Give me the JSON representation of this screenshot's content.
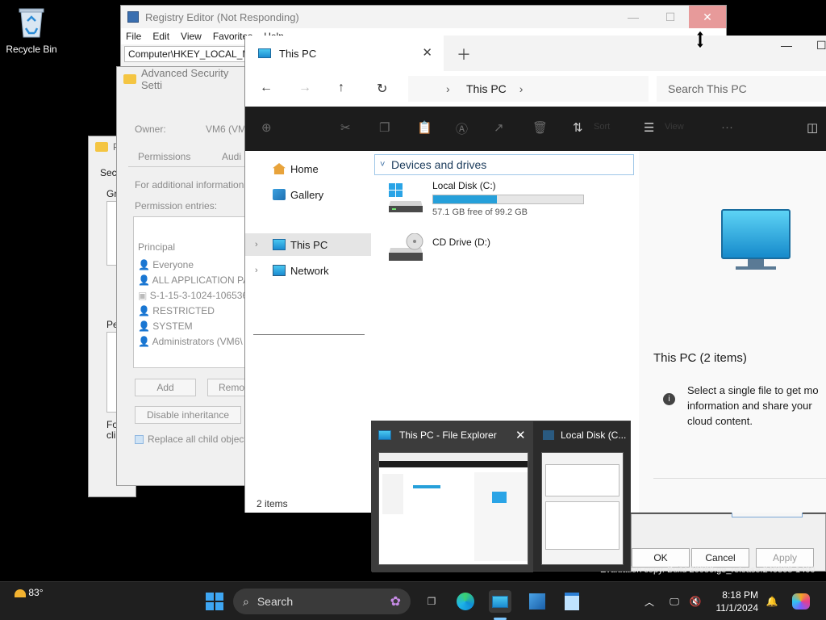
{
  "desktop": {
    "recycle_bin_label": "Recycle Bin"
  },
  "registry_editor": {
    "title": "Registry Editor (Not Responding)",
    "menu": [
      "File",
      "Edit",
      "View",
      "Favorites",
      "Help"
    ],
    "address": "Computer\\HKEY_LOCAL_MA"
  },
  "permissions_dialog": {
    "title_partial": "P",
    "tab_partial": "Sec",
    "group_partial": "Gr",
    "perm_partial": "Pe",
    "footer_partial_1": "Fo",
    "footer_partial_2": "cli"
  },
  "advanced_security": {
    "title": "Advanced Security Setti",
    "owner_label": "Owner:",
    "owner_value": "VM6 (VM",
    "tabs": [
      "Permissions",
      "Audi"
    ],
    "additional_info": "For additional information",
    "permission_entries_label": "Permission entries:",
    "principal_header": "Principal",
    "principals": [
      "Everyone",
      "ALL APPLICATION PA",
      "S-1-15-3-1024-106536",
      "RESTRICTED",
      "SYSTEM",
      "Administrators (VM6\\"
    ],
    "add_button": "Add",
    "remove_button": "Remo",
    "disable_inheritance": "Disable inheritance",
    "replace_child": "Replace all child object"
  },
  "bottom_dialog": {
    "ok": "OK",
    "cancel": "Cancel",
    "apply": "Apply"
  },
  "watermark": "Evaluation copy. Build 26080.ge_release.240308-1400",
  "explorer": {
    "tab_title": "This PC",
    "breadcrumb": "This PC",
    "search_placeholder": "Search This PC",
    "cmd_sort": "Sort",
    "cmd_view": "View",
    "sidebar": {
      "home": "Home",
      "gallery": "Gallery",
      "this_pc": "This PC",
      "network": "Network"
    },
    "group_label": "Devices and drives",
    "drives": [
      {
        "name": "Local Disk (C:)",
        "free_text": "57.1 GB free of 99.2 GB",
        "used_fraction": 0.424
      },
      {
        "name": "CD Drive (D:)"
      }
    ],
    "status": "2 items",
    "preview": {
      "title": "This PC (2 items)",
      "info": "Select a single file to get mo information and share your cloud content."
    }
  },
  "thumbnails": [
    {
      "title": "This PC - File Explorer"
    },
    {
      "title": "Local Disk (C..."
    }
  ],
  "taskbar": {
    "weather_temp": "83°",
    "search_label": "Search",
    "time": "8:18 PM",
    "date": "11/1/2024"
  },
  "colors": {
    "accent": "#26a0da",
    "taskbar": "#1f1f1f",
    "command_bar": "#1c1c1c"
  }
}
